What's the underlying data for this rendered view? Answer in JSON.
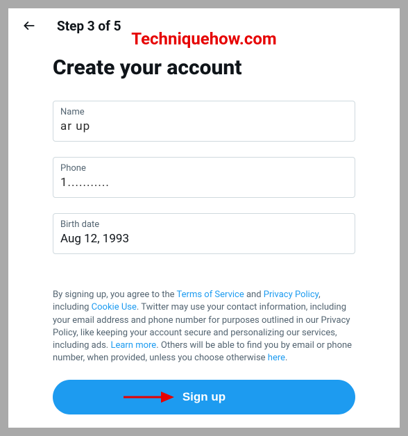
{
  "header": {
    "step_label": "Step 3 of 5"
  },
  "watermark": "Techniquehow.com",
  "title": "Create your account",
  "fields": {
    "name": {
      "label": "Name",
      "value": "ar up"
    },
    "phone": {
      "label": "Phone",
      "value": "1..........."
    },
    "birth": {
      "label": "Birth date",
      "value": "Aug 12, 1993"
    }
  },
  "disclosure": {
    "pre": "By signing up, you agree to the ",
    "tos": "Terms of Service",
    "and": " and ",
    "privacy": "Privacy Policy",
    "including": ", including ",
    "cookie": "Cookie Use",
    "mid": ". Twitter may use your contact information, including your email address and phone number for purposes outlined in our Privacy Policy, like keeping your account secure and personalizing our services, including ads. ",
    "learn": "Learn more",
    "tail": ". Others will be able to find you by email or phone number, when provided, unless you choose otherwise ",
    "here": "here",
    "end": "."
  },
  "signup_label": "Sign up"
}
